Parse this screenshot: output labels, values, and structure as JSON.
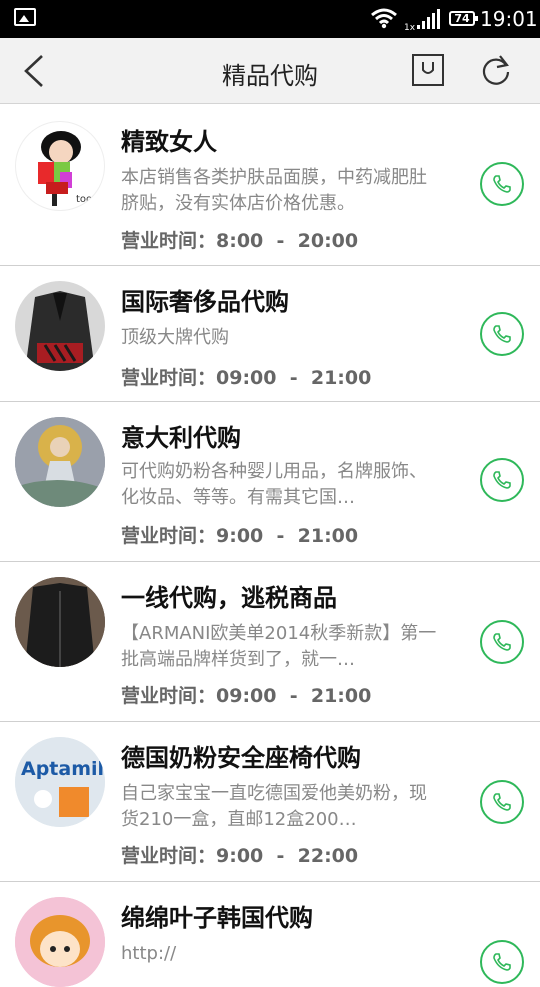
{
  "status_bar": {
    "time": "19:01",
    "battery": "74",
    "network": "1x"
  },
  "header": {
    "title": "精品代购"
  },
  "colors": {
    "accent": "#2fb85a"
  },
  "shops": [
    {
      "name": "精致女人",
      "description": "本店销售各类护肤品面膜，中药减肥肚脐贴，没有实体店价格优惠。",
      "hours_label": "营业时间：",
      "open": "8:00",
      "close": "20:00",
      "avatar": "doll-illustration"
    },
    {
      "name": "国际奢侈品代购",
      "description": "顶级大牌代购",
      "hours_label": "营业时间：",
      "open": "09:00",
      "close": "21:00",
      "avatar": "black-suit-jacket"
    },
    {
      "name": "意大利代购",
      "description": "可代购奶粉各种婴儿用品，名牌服饰、化妆品、等等。有需其它国…",
      "hours_label": "营业时间：",
      "open": "9:00",
      "close": "21:00",
      "avatar": "goddess-painting"
    },
    {
      "name": "一线代购，逃税商品",
      "description": "【ARMANI欧美单2014秋季新款】第一批高端品牌样货到了，就一…",
      "hours_label": "营业时间：",
      "open": "09:00",
      "close": "21:00",
      "avatar": "black-jacket"
    },
    {
      "name": "德国奶粉安全座椅代购",
      "description": "自己家宝宝一直吃德国爱他美奶粉，现货210一盒，直邮12盒200…",
      "hours_label": "营业时间：",
      "open": "9:00",
      "close": "22:00",
      "avatar": "aptamil-box",
      "avatar_brand": "Aptamil"
    },
    {
      "name": "绵绵叶子韩国代购",
      "description": "http://",
      "avatar": "cartoon-girl"
    }
  ]
}
